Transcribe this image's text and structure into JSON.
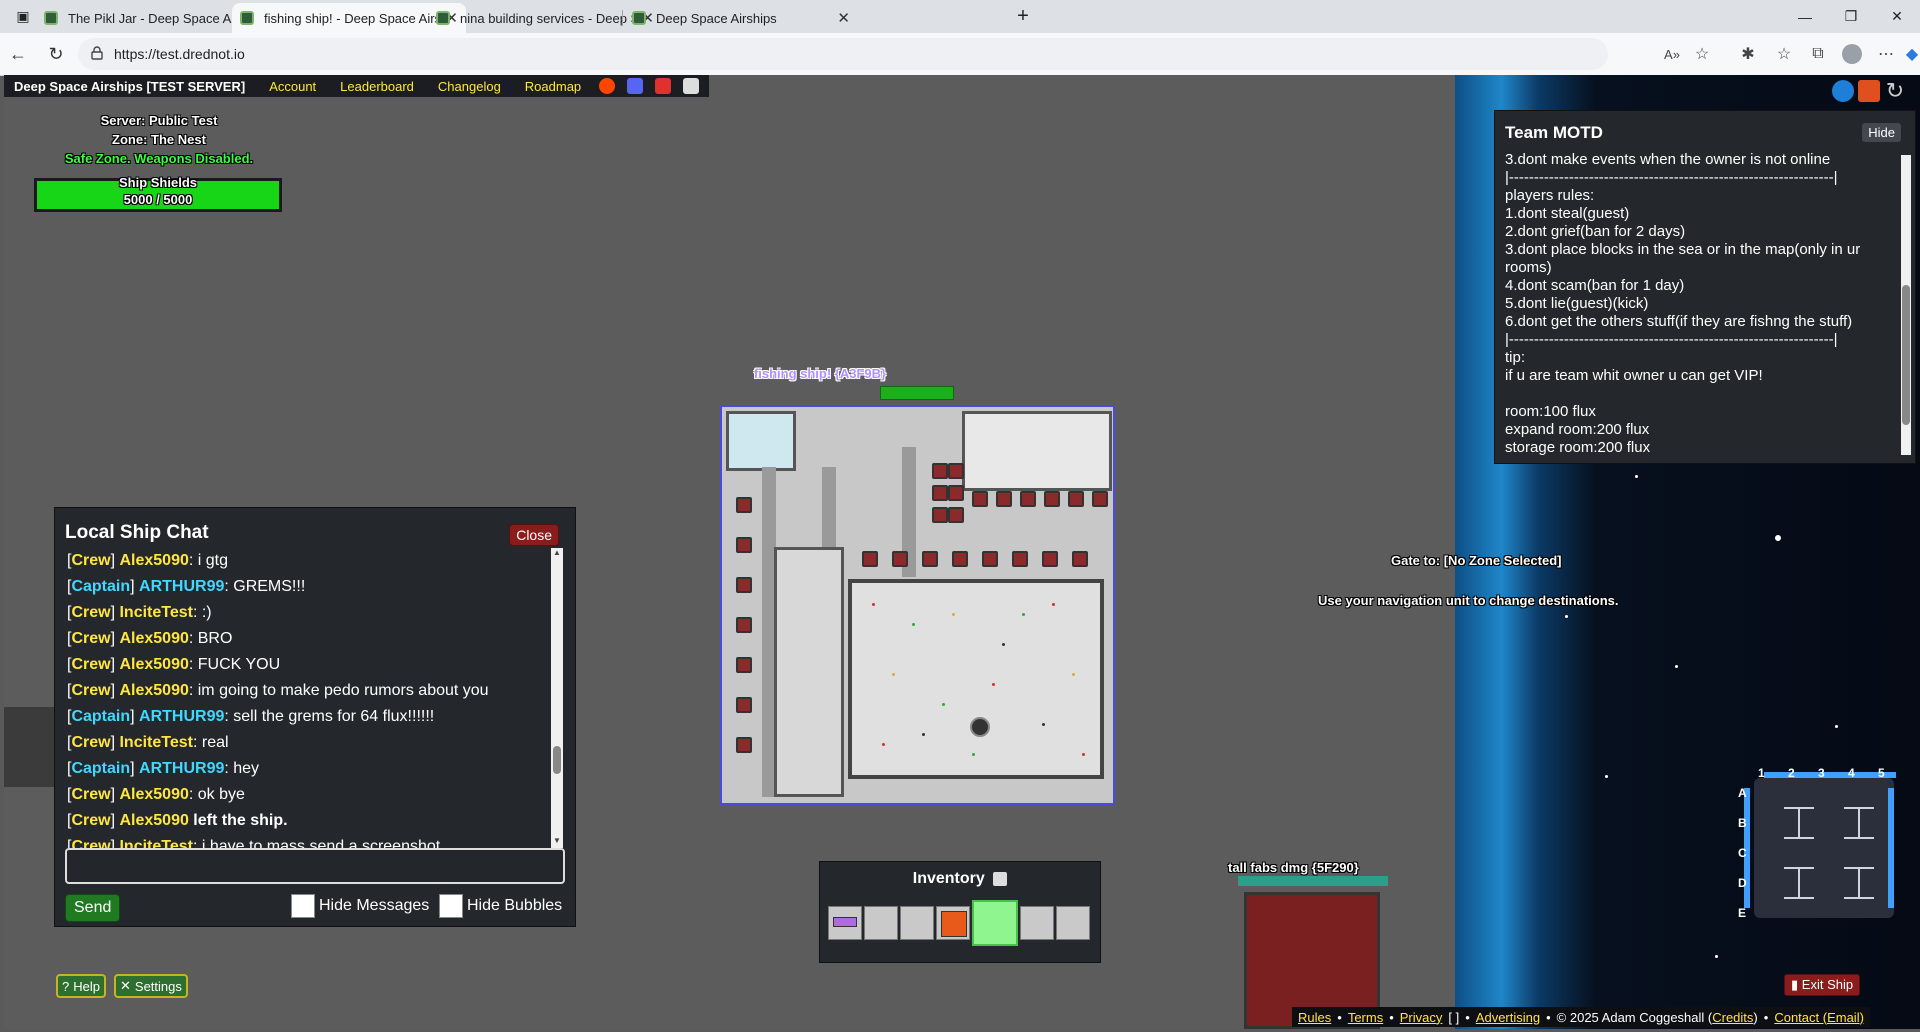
{
  "browser": {
    "tabs": [
      {
        "title": "The Pikl Jar - Deep Space A"
      },
      {
        "title": "fishing ship! - Deep Space Airship"
      },
      {
        "title": "nina building services - Deep Spa"
      },
      {
        "title": "Deep Space Airships"
      }
    ],
    "url": "https://test.drednot.io"
  },
  "topbar": {
    "title": "Deep Space Airships [TEST SERVER]",
    "links": [
      "Account",
      "Leaderboard",
      "Changelog",
      "Roadmap"
    ]
  },
  "status": {
    "server": "Server: Public Test",
    "zone": "Zone: The Nest",
    "safe": "Safe Zone. Weapons Disabled.",
    "shield_label": "Ship Shields",
    "shield_value": "5000 / 5000",
    "shield_fraction": 1.0
  },
  "chat": {
    "title": "Local Ship Chat",
    "close_label": "Close",
    "messages": [
      {
        "role": "Crew",
        "name": "Alex5090",
        "text": ": i gtg"
      },
      {
        "role": "Captain",
        "name": "ARTHUR99",
        "text": ": GREMS!!!"
      },
      {
        "role": "Crew",
        "name": "InciteTest",
        "text": ": :)"
      },
      {
        "role": "Crew",
        "name": "Alex5090",
        "text": ": BRO"
      },
      {
        "role": "Crew",
        "name": "Alex5090",
        "text": ": FUCK YOU"
      },
      {
        "role": "Crew",
        "name": "Alex5090",
        "text": ": im going to make pedo rumors about you"
      },
      {
        "role": "Captain",
        "name": "ARTHUR99",
        "text": ": sell the grems for 64 flux!!!!!!"
      },
      {
        "role": "Crew",
        "name": "InciteTest",
        "text": ": real"
      },
      {
        "role": "Captain",
        "name": "ARTHUR99",
        "text": ": hey"
      },
      {
        "role": "Crew",
        "name": "Alex5090",
        "text": ": ok bye"
      },
      {
        "role": "Crew",
        "name": "Alex5090",
        "text": " left the ship."
      },
      {
        "role": "Crew",
        "name": "InciteTest",
        "text": ": i have to mass send a screenshot"
      }
    ],
    "send_label": "Send",
    "hide_messages_label": "Hide Messages",
    "hide_bubbles_label": "Hide Bubbles"
  },
  "bottom_left": {
    "help_label": "Help",
    "settings_label": "Settings"
  },
  "ship": {
    "name": "fishing ship! {A3F9B}"
  },
  "gate": {
    "line1": "Gate to: [No Zone Selected]",
    "line2": "Use your navigation unit to change destinations."
  },
  "inventory": {
    "title": "Inventory"
  },
  "motd": {
    "title": "Team MOTD",
    "hide_label": "Hide",
    "text": "3.dont make events when the owner is not online\n|-----------------------------------------------------------------|\nplayers rules:\n1.dont steal(guest)\n2.dont grief(ban for 2 days)\n3.dont place blocks in the sea or in the map(only in ur rooms)\n4.dont scam(ban for 1 day)\n5.dont lie(guest)(kick)\n6.dont get the others stuff(if they are fishng the stuff)\n|-----------------------------------------------------------------|\ntip:\nif u are team whit owner u can get VIP!\n\nroom:100 flux\nexpand room:200 flux\nstorage room:200 flux"
  },
  "other_ship": {
    "name": "tall fabs dmg {5F290}"
  },
  "minimap": {
    "cols": [
      "1",
      "2",
      "3",
      "4",
      "5"
    ],
    "rows": [
      "A",
      "B",
      "C",
      "D",
      "E"
    ]
  },
  "exit_label": "Exit Ship",
  "footer": {
    "rules": "Rules",
    "terms": "Terms",
    "privacy": "Privacy",
    "privacy_extra": "[ ]",
    "advertising": "Advertising",
    "copyright": "© 2025 Adam Coggeshall (",
    "credits": "Credits",
    "copyright_end": ")",
    "contact": "Contact (Email)"
  }
}
